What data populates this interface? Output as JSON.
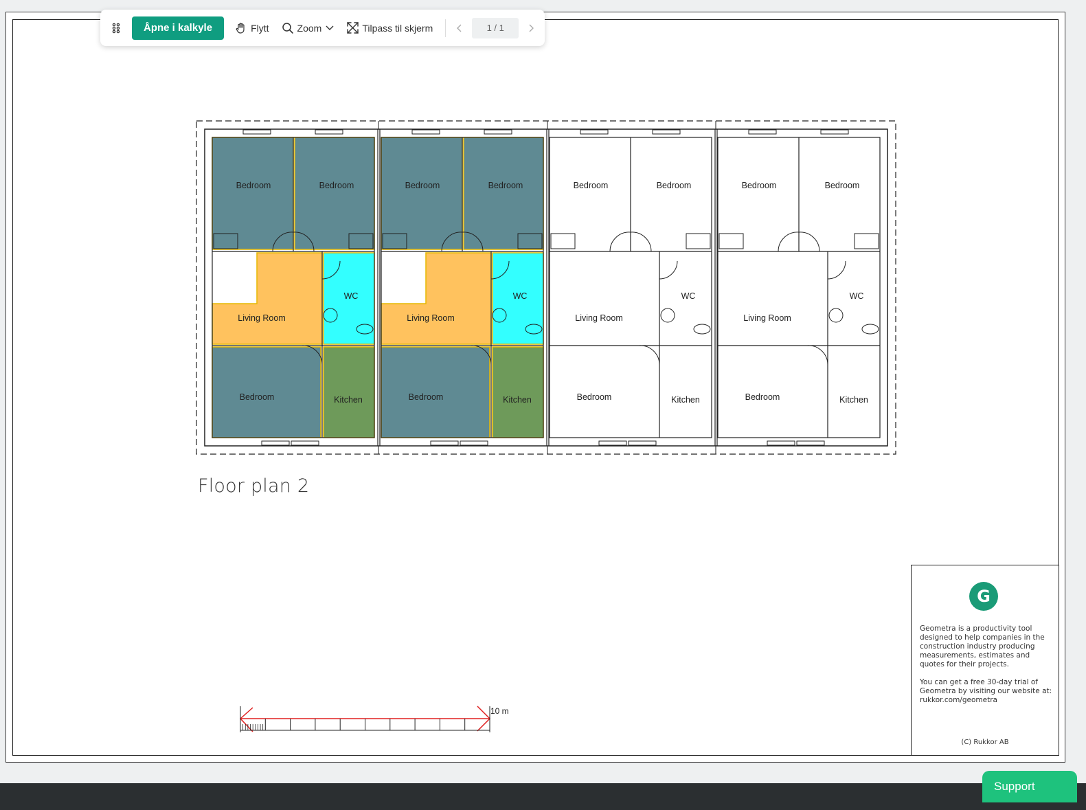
{
  "toolbar": {
    "open_button": "Åpne i kalkyle",
    "move": "Flytt",
    "zoom": "Zoom",
    "fit": "Tilpass til skjerm",
    "page_indicator": "1 / 1"
  },
  "drawing": {
    "title": "Floor plan 2",
    "scale_label": "10 m",
    "rooms": [
      "Bedroom",
      "Bedroom",
      "Living Room",
      "WC",
      "Bedroom",
      "Kitchen"
    ]
  },
  "title_block": {
    "logo_letter": "G",
    "para1": "Geometra is a productivity tool designed to help companies in the construction industry producing measurements, estimates and quotes for their projects.",
    "para2": "You can get a free 30-day trial of Geometra by visiting our website at: rukkor.com/geometra",
    "copyright": "(C) Rukkor AB"
  },
  "support_button": "Support",
  "colors": {
    "accent": "#0f9d80",
    "bedroom_fill": "#5f8a93",
    "living_fill": "#ffc25e",
    "wc_fill": "#33ffff",
    "kitchen_fill": "#6e9a5a",
    "highlight_border": "#e6b800",
    "scale_red": "#e02020"
  }
}
